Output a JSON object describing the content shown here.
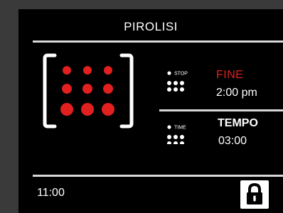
{
  "header": {
    "title": "PIROLISI"
  },
  "oven_graphic": {
    "icon": "oven-cavity-heat-icon",
    "accent_color": "#e2201f"
  },
  "stop_block": {
    "icon_caption": "STOP",
    "label": "FINE",
    "value": "2:00 pm",
    "label_color": "#e2201f"
  },
  "time_block": {
    "icon_caption": "TIME",
    "label": "TEMPO",
    "value": "03:00"
  },
  "footer": {
    "clock": "11:00",
    "lock_icon": "padlock-locked-icon"
  }
}
